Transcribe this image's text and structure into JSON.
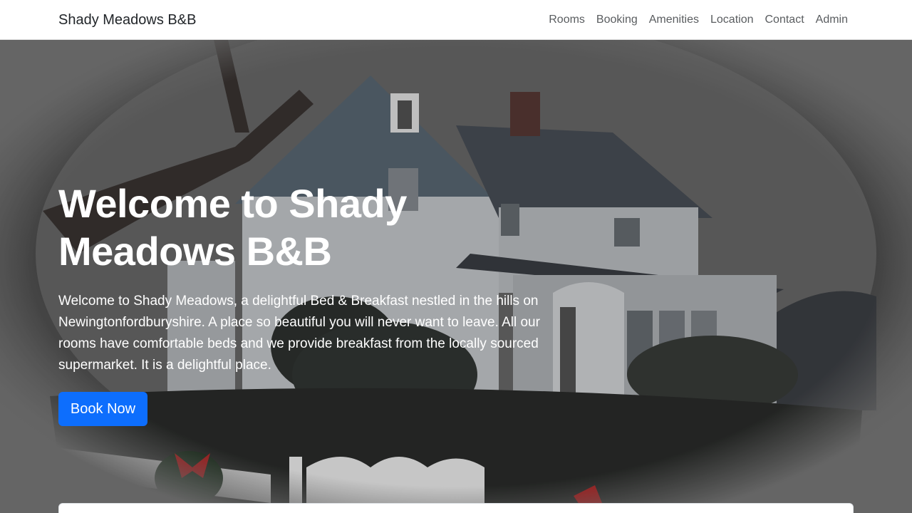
{
  "nav": {
    "brand": "Shady Meadows B&B",
    "links": [
      "Rooms",
      "Booking",
      "Amenities",
      "Location",
      "Contact",
      "Admin"
    ]
  },
  "hero": {
    "title": "Welcome to Shady Meadows B&B",
    "description": "Welcome to Shady Meadows, a delightful Bed & Breakfast nestled in the hills on Newingtonfordburyshire. A place so beautiful you will never want to leave. All our rooms have comfortable beds and we provide breakfast from the locally sourced supermarket. It is a delightful place.",
    "button_label": "Book Now"
  },
  "colors": {
    "primary": "#0d6efd",
    "navbar_bg": "#ffffff",
    "hero_overlay": "#7a7a7a"
  }
}
